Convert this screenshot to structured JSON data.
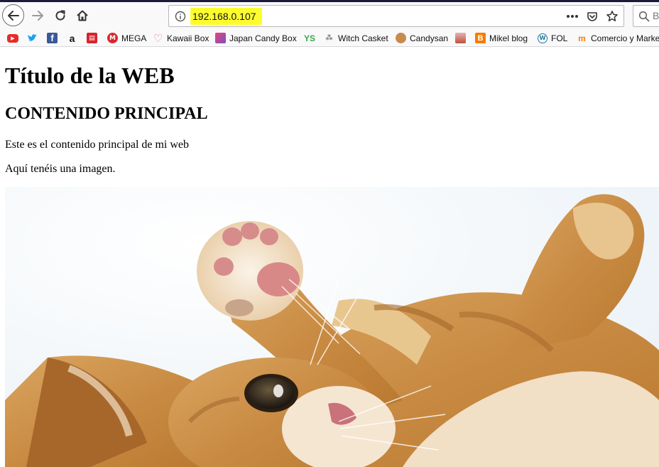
{
  "browser": {
    "url": "192.168.0.107",
    "search_placeholder": "B",
    "highlight_color": "#fdfd2e"
  },
  "bookmarks": [
    {
      "label": "",
      "icon": "youtube-icon"
    },
    {
      "label": "",
      "icon": "twitter-icon"
    },
    {
      "label": "",
      "icon": "facebook-icon"
    },
    {
      "label": "",
      "icon": "amazon-icon"
    },
    {
      "label": "",
      "icon": "cart-icon"
    },
    {
      "label": "MEGA",
      "icon": "mega-icon"
    },
    {
      "label": "Kawaii Box",
      "icon": "heart-icon"
    },
    {
      "label": "Japan Candy Box",
      "icon": "candy-icon"
    },
    {
      "label": "YS",
      "icon": ""
    },
    {
      "label": "Witch Casket",
      "icon": "witch-casket-icon"
    },
    {
      "label": "Candysan",
      "icon": "candysan-icon"
    },
    {
      "label": "",
      "icon": "box-icon"
    },
    {
      "label": "Mikel blog",
      "icon": "blogger-icon"
    },
    {
      "label": "FOL",
      "icon": "wordpress-icon"
    },
    {
      "label": "Comercio y Market",
      "icon": "moodle-icon"
    }
  ],
  "page": {
    "title": "Título de la WEB",
    "heading": "CONTENIDO PRINCIPAL",
    "paragraph_1": "Este es el contenido principal de mi web",
    "paragraph_2": "Aquí tenéis una imagen."
  }
}
